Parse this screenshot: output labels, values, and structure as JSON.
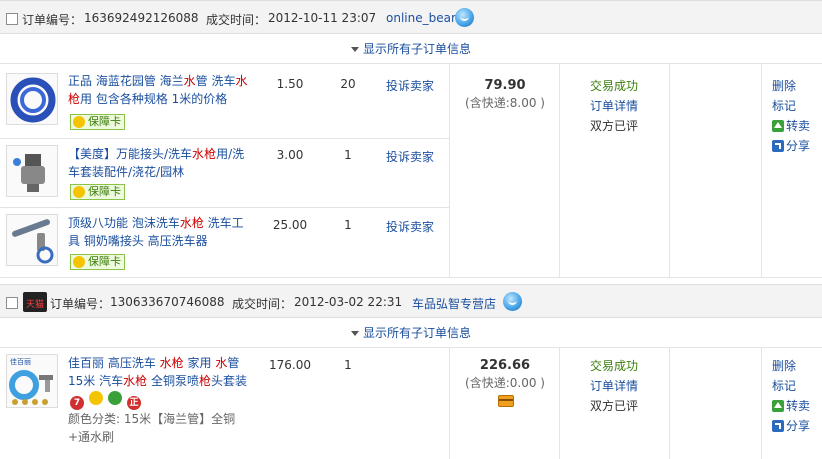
{
  "orders": [
    {
      "order_no_label": "订单编号：",
      "order_no": "163692492126088",
      "deal_time_label": "成交时间：",
      "deal_time": "2012-10-11 23:07",
      "seller": "online_bear",
      "show_all": "显示所有子订单信息",
      "items": [
        {
          "title_parts": [
            "正品 海蓝花园管 海兰",
            "水",
            "管 洗车",
            "水",
            "",
            "枪",
            "用 包含各种规格 1米的价格"
          ],
          "price": "1.50",
          "qty": "20",
          "complain": "投诉卖家",
          "badge": "保障卡"
        },
        {
          "title_parts": [
            "【美度】万能接头/洗车",
            "水",
            "",
            "枪",
            "用/洗车套装配件/浇花/园林",
            "",
            ""
          ],
          "price": "3.00",
          "qty": "1",
          "complain": "投诉卖家",
          "badge": "保障卡"
        },
        {
          "title_parts": [
            "顶级八功能 泡沫洗车",
            "水",
            "",
            "枪",
            " 洗车工具 铜奶嘴接头 高压洗车器",
            "",
            ""
          ],
          "price": "25.00",
          "qty": "1",
          "complain": "投诉卖家",
          "badge": "保障卡"
        }
      ],
      "total": "79.90",
      "shipping": "(含快递:8.00 )",
      "status": "交易成功",
      "detail": "订单详情",
      "rated": "双方已评",
      "ops": {
        "delete": "删除",
        "mark": "标记",
        "resell": "转卖",
        "share": "分享"
      }
    },
    {
      "order_no_label": "订单编号：",
      "order_no": "130633670746088",
      "deal_time_label": "成交时间：",
      "deal_time": "2012-03-02 22:31",
      "seller": "车品弘智专营店",
      "tmall_badge": "天猫",
      "show_all": "显示所有子订单信息",
      "items": [
        {
          "title_parts": [
            "佳百丽 高压洗车 ",
            "水",
            "",
            "枪",
            " 家用 ",
            "水",
            "管 15米 汽车",
            "水",
            "",
            "枪",
            " 全铜泵喷",
            "枪",
            "头套装"
          ],
          "price": "176.00",
          "qty": "1",
          "sku": "颜色分类: 15米【海兰管】全铜+通水刷",
          "mini_badges": [
            "7",
            "",
            "",
            "正"
          ]
        }
      ],
      "total": "226.66",
      "shipping": "(含快递:0.00 )",
      "status": "交易成功",
      "detail": "订单详情",
      "rated": "双方已评",
      "ops": {
        "delete": "删除",
        "mark": "标记",
        "resell": "转卖",
        "share": "分享"
      }
    }
  ]
}
